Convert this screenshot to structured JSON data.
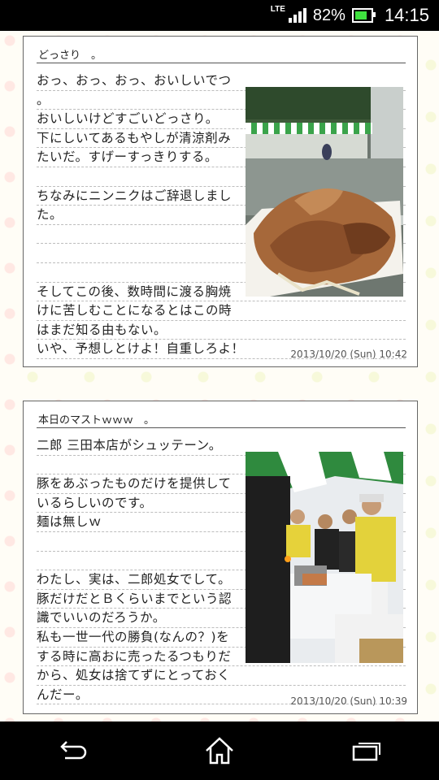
{
  "status_bar": {
    "network": "LTE",
    "battery_percent": "82%",
    "battery_level": 0.82,
    "time": "14:15"
  },
  "posts": [
    {
      "title": "どっさり　。",
      "lines": [
        "おっ、おっ、おっ、おいしいでつ",
        "。",
        "おいしいけどすごいどっさり。",
        "下にしいてあるもやしが清涼剤み",
        "たいだ。すげーすっきりする。",
        "",
        "ちなみにニンニクはご辞退しまし",
        "た。",
        "",
        "",
        "",
        "そしてこの後、数時間に渡る胸焼",
        "けに苦しむことになるとはこの時",
        "はまだ知る由もない。",
        "いや、予想しとけよ！自重しろよ！"
      ],
      "date": "2013/10/20 (Sun) 10:42",
      "photo": "grilled-pork-meat-photo"
    },
    {
      "title": "本日のマストｗｗｗ　。",
      "lines": [
        "二郎 三田本店がシュッテーン。",
        "",
        "豚をあぶったものだけを提供して",
        "いるらしいのです。",
        "麺は無しｗ",
        "",
        "",
        "わたし、実は、二郎処女でして。",
        "豚だけだとＢくらいまでという認",
        "識でいいのだろうか。",
        "私も一世一代の勝負(なんの？)を",
        "する時に高おに売ったるつもりだ",
        "から、処女は捨てずにとっておく",
        "んだー。"
      ],
      "date": "2013/10/20 (Sun) 10:39",
      "photo": "food-stall-staff-photo"
    }
  ],
  "nav_bar": {
    "back": "back-icon",
    "home": "home-icon",
    "recents": "recent-apps-icon"
  }
}
